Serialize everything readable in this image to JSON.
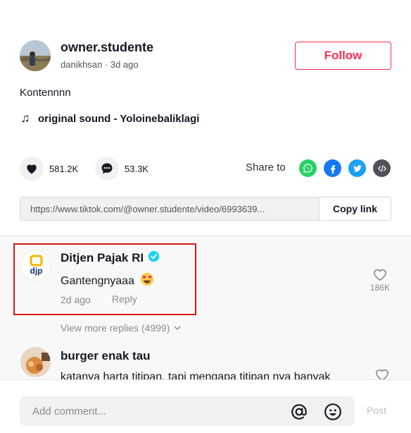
{
  "author": {
    "username": "owner.studente",
    "nickname": "danikhsan",
    "separator": " · ",
    "posted": "3d ago",
    "follow_label": "Follow"
  },
  "post": {
    "description": "Kontennnn",
    "music": "original sound - Yoloinebaliklagi"
  },
  "stats": {
    "likes": "581.2K",
    "comments": "53.3K"
  },
  "share": {
    "label": "Share to",
    "targets": [
      "whatsapp-icon",
      "facebook-icon",
      "twitter-icon",
      "embed-icon"
    ]
  },
  "link": {
    "url": "https://www.tiktok.com/@owner.studente/video/6993639...",
    "copy_label": "Copy link"
  },
  "comments": [
    {
      "author": "Ditjen Pajak RI",
      "verified": true,
      "avatar_text": "djp",
      "text": "Gantengnyaaa",
      "emoji": "😍",
      "time": "2d ago",
      "reply_label": "Reply",
      "likes": "186K",
      "highlighted": true,
      "view_more": "View more replies (4999)"
    },
    {
      "author": "burger enak tau",
      "text": "katanya harta titipan, tapi mengapa titipan nya banyak"
    }
  ],
  "composer": {
    "placeholder": "Add comment...",
    "post_label": "Post"
  },
  "colors": {
    "accent": "#fe2c55",
    "highlight_border": "#d61a1a",
    "verified": "#20d5ec",
    "whatsapp": "#25d366",
    "facebook": "#1877f2",
    "twitter": "#1da1f2",
    "embed": "#505258"
  }
}
